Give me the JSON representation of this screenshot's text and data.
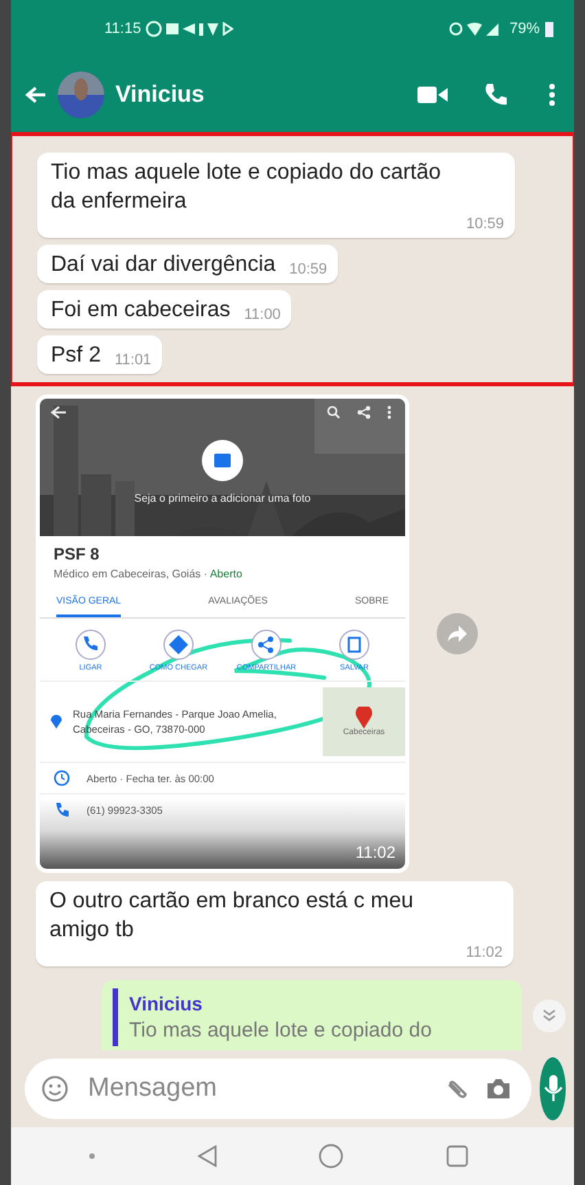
{
  "status_bar": {
    "time": "11:15",
    "battery": "79%"
  },
  "header": {
    "contact": "Vinicius"
  },
  "messages": [
    {
      "kind": "text",
      "highlighted": true,
      "text": "Tio mas aquele lote e copiado do cartão da enfermeira",
      "time": "10:59"
    },
    {
      "kind": "text",
      "highlighted": true,
      "text": "Daí vai dar divergência",
      "time": "10:59"
    },
    {
      "kind": "text",
      "highlighted": true,
      "text": "Foi em cabeceiras",
      "time": "11:00"
    },
    {
      "kind": "text",
      "highlighted": true,
      "text": "Psf 2",
      "time": "11:01"
    },
    {
      "highlighted": false,
      "time": "11:02",
      "shot": {
        "photo_caption": "Seja o primeiro a adicionar uma foto",
        "place": "PSF 8",
        "subtitle": "Médico em Cabeceiras, Goiás · ",
        "status": "Aberto",
        "tabs": [
          {
            "label": "VISÃO GERAL",
            "selected": true
          },
          {
            "label": "AVALIAÇÕES",
            "selected": false
          },
          {
            "label": "SOBRE",
            "selected": false
          }
        ],
        "actions": [
          "LIGAR",
          "COMO CHEGAR",
          "COMPARTILHAR",
          "SALVAR"
        ],
        "address": "Rua Maria Fernandes - Parque Joao Amelia, Cabeceiras - GO, 73870-000",
        "map_label": "Cabeceiras",
        "hours": "Aberto · Fecha ter. às 00:00",
        "phone": "(61) 99923-3305"
      }
    },
    {
      "kind": "text",
      "highlighted": false,
      "text": "O outro cartão em branco está c meu amigo tb",
      "time": "11:02"
    },
    {
      "kind": "reply",
      "highlighted": false,
      "quote_author": "Vinicius",
      "quote_text": "Tio mas aquele lote e copiado do"
    }
  ],
  "composer": {
    "placeholder": "Mensagem"
  }
}
